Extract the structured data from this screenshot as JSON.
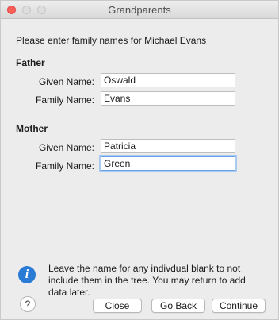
{
  "window": {
    "title": "Grandparents"
  },
  "prompt": "Please enter family names for Michael Evans",
  "father": {
    "heading": "Father",
    "given_label": "Given Name:",
    "given_value": "Oswald",
    "family_label": "Family Name:",
    "family_value": "Evans"
  },
  "mother": {
    "heading": "Mother",
    "given_label": "Given Name:",
    "given_value": "Patricia",
    "family_label": "Family Name:",
    "family_value": "Green"
  },
  "info": {
    "icon": "info-icon",
    "text": "Leave the name for any indivdual blank to not include them in the tree. You may return to add data later."
  },
  "buttons": {
    "help": "?",
    "close": "Close",
    "go_back": "Go Back",
    "continue": "Continue"
  },
  "colors": {
    "accent": "#2a7bd5",
    "focus": "#6aa2e8",
    "close_light": "#fc5f57"
  }
}
